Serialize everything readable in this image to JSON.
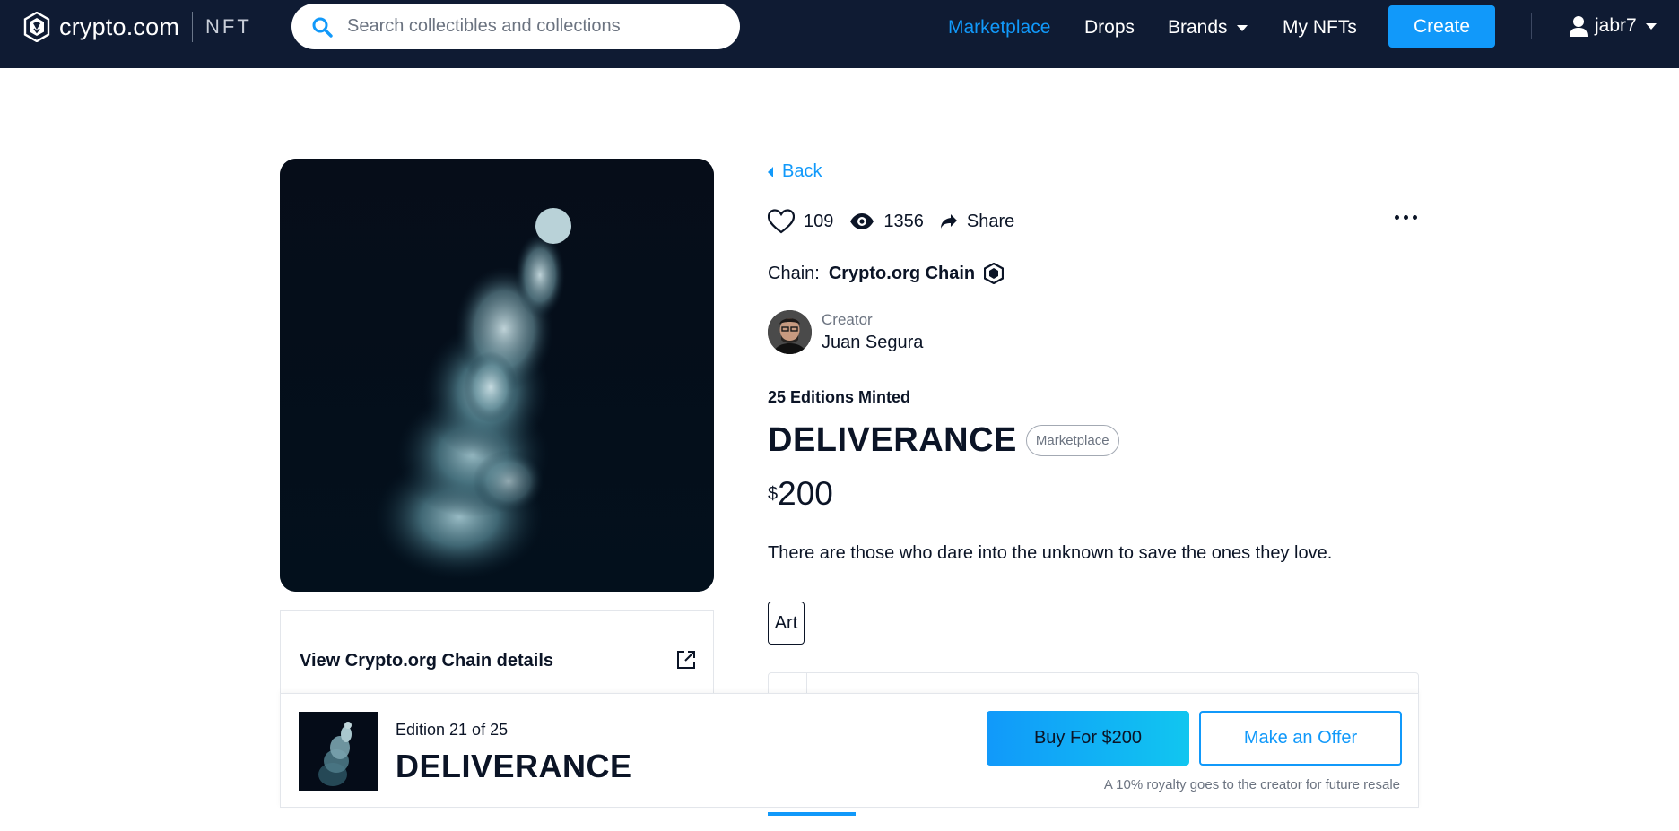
{
  "header": {
    "logo_text": "crypto.com",
    "logo_suffix": "NFT",
    "search_placeholder": "Search collectibles and collections",
    "nav": {
      "marketplace": "Marketplace",
      "drops": "Drops",
      "brands": "Brands",
      "my_nfts": "My NFTs"
    },
    "create_label": "Create",
    "username": "jabr7"
  },
  "details": {
    "back_label": "Back",
    "likes": "109",
    "views": "1356",
    "share_label": "Share",
    "chain_label": "Chain:",
    "chain_name": "Crypto.org Chain",
    "creator_label": "Creator",
    "creator_name": "Juan Segura",
    "editions_minted": "25 Editions Minted",
    "title": "DELIVERANCE",
    "badge": "Marketplace",
    "price_currency": "$",
    "price_value": "200",
    "description": "There are those who dare into the unknown to save the ones they love.",
    "tag": "Art"
  },
  "chain_card": {
    "link_label": "View Crypto.org Chain details"
  },
  "buy_bar": {
    "edition": "Edition 21 of 25",
    "title": "DELIVERANCE",
    "buy_label": "Buy For $200",
    "offer_label": "Make an Offer",
    "royalty_note": "A 10% royalty goes to the creator for future resale"
  },
  "colors": {
    "header_bg": "#0f1b33",
    "accent": "#1199fa",
    "text": "#0b1426",
    "muted": "#6b7380"
  },
  "icons": [
    "crypto-com-logo-icon",
    "search-icon",
    "caret-down-icon",
    "user-icon",
    "back-caret-icon",
    "heart-icon",
    "eye-icon",
    "share-icon",
    "more-dots-icon",
    "chain-hexagon-icon",
    "external-link-icon"
  ]
}
